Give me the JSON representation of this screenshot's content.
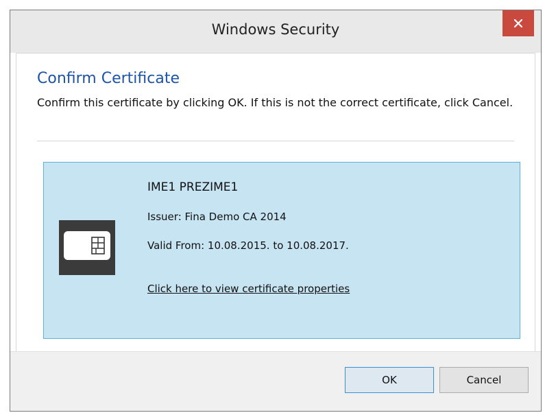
{
  "window": {
    "title": "Windows Security"
  },
  "dialog": {
    "heading": "Confirm Certificate",
    "description": "Confirm this certificate by clicking OK. If this is not the correct certificate, click Cancel."
  },
  "certificate": {
    "name": "IME1 PREZIME1",
    "issuer": "Issuer: Fina Demo CA 2014",
    "valid": "Valid From: 10.08.2015. to 10.08.2017.",
    "link_text": "Click here to view certificate properties",
    "icon": "smart-card-icon"
  },
  "buttons": {
    "ok": "OK",
    "cancel": "Cancel"
  },
  "colors": {
    "close_button": "#c9493f",
    "heading": "#1d53a8",
    "tile_background": "#c7e4f2",
    "tile_border": "#5fb1dc"
  }
}
